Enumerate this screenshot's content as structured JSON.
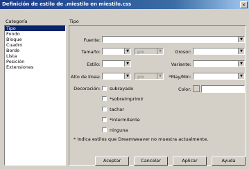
{
  "window": {
    "title": "Definición de estilo de .miestilo en miestilo.css",
    "close": "×"
  },
  "categories_label": "Categoría",
  "type_label": "Tipo",
  "categories": [
    "Tipo",
    "Fondo",
    "Bloque",
    "Cuadro",
    "Borde",
    "Lista",
    "Posición",
    "Extensiones"
  ],
  "selected_category": "Tipo",
  "labels": {
    "font": "Fuente:",
    "size": "Tamaño:",
    "weight": "Grosor:",
    "style": "Estilo:",
    "variant": "Variante:",
    "line_height": "Alto de línea:",
    "case": "*May/Min:",
    "decoration": "Decoración:",
    "color": "Color:"
  },
  "units": {
    "size": "píx",
    "line_height": "píx"
  },
  "decorations": [
    "subrayado",
    "*sobreimprimir",
    "tachar",
    "*intermitente",
    "ninguna"
  ],
  "footnote": "* Indica estilos que Dreamweaver no muestra actualmente.",
  "buttons": {
    "ok": "Aceptar",
    "cancel": "Cancelar",
    "apply": "Aplicar",
    "help": "Ayuda"
  }
}
